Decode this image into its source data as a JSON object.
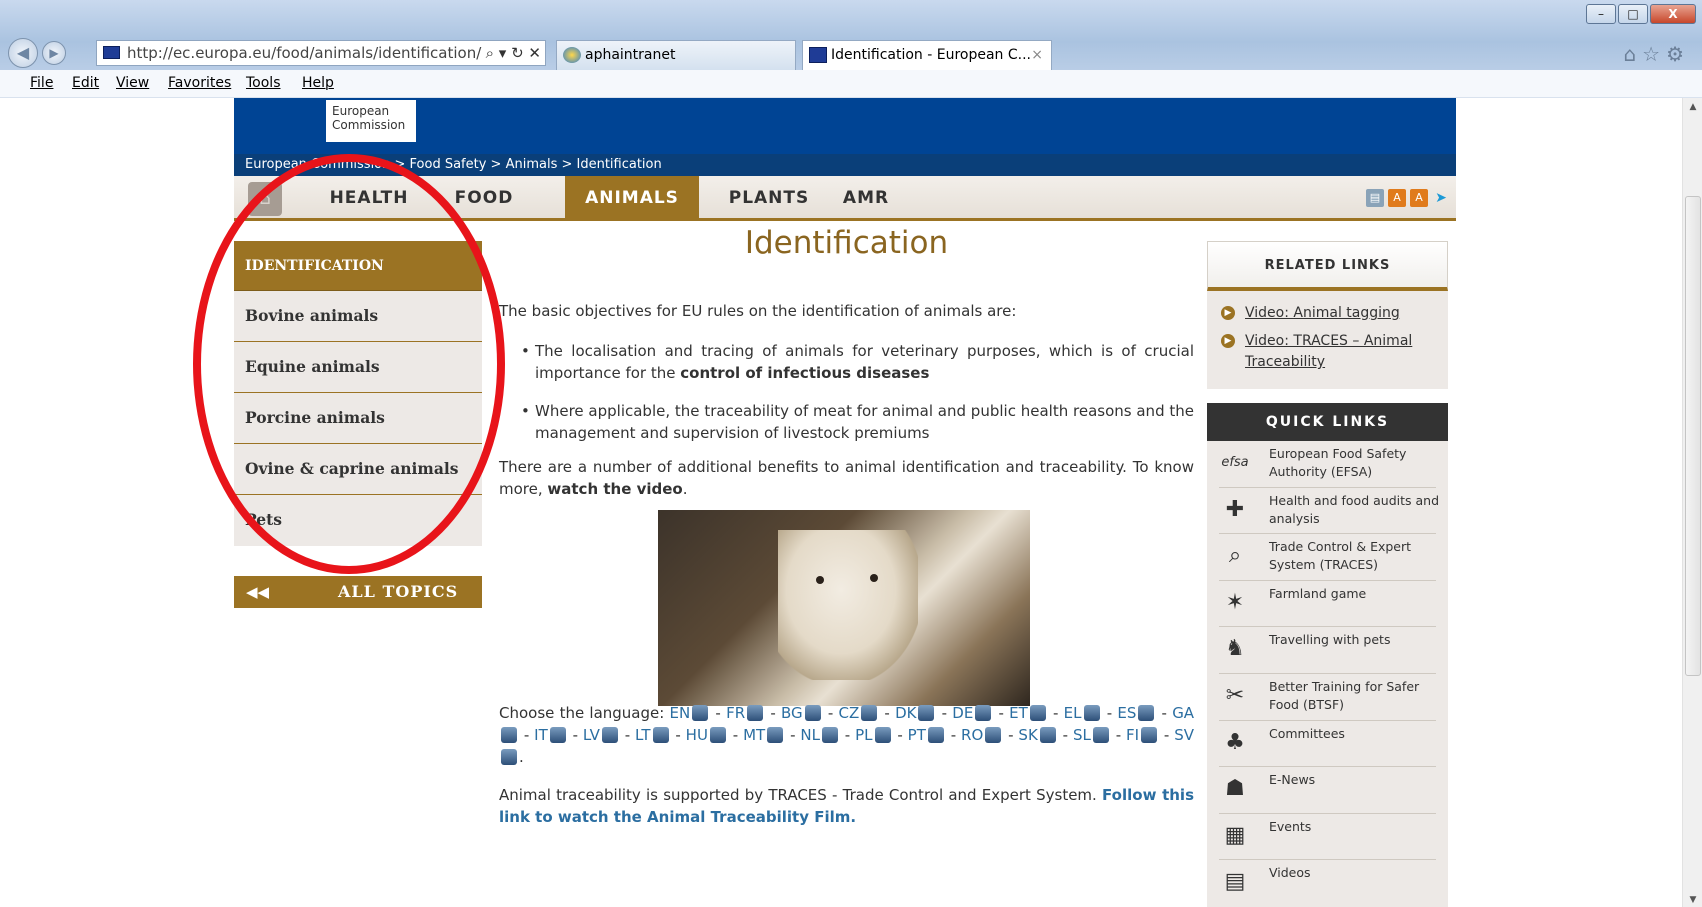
{
  "browser": {
    "url": "http://ec.europa.eu/food/animals/identification/in",
    "url_tools": "⌕ ▾ ↻ ✕",
    "tabs": [
      {
        "label": "aphaintranet"
      },
      {
        "label": "Identification - European C...",
        "close": "×"
      }
    ],
    "menu": [
      "File",
      "Edit",
      "View",
      "Favorites",
      "Tools",
      "Help"
    ],
    "window_buttons": [
      "–",
      "□",
      "X"
    ],
    "right_icons": "⌂☆⚙"
  },
  "site": {
    "logo": [
      "European",
      "Commission"
    ],
    "breadcrumb": "European Commission > Food Safety > Animals > Identification",
    "nav": [
      "HEALTH",
      "FOOD",
      "ANIMALS",
      "PLANTS",
      "AMR"
    ],
    "nav_active": "ANIMALS"
  },
  "sidebar": {
    "header": "IDENTIFICATION",
    "items": [
      "Bovine animals",
      "Equine animals",
      "Porcine animals",
      "Ovine & caprine animals",
      "Pets"
    ],
    "all_topics": "ALL TOPICS",
    "all_topics_arrow": "◀◀"
  },
  "main": {
    "title": "Identification",
    "intro": "The basic objectives for EU rules on the identification of animals are:",
    "bullet1_pre": "The localisation and tracing of animals for veterinary purposes, which is of crucial importance for the ",
    "bullet1_bold": "control of infectious diseases",
    "bullet2": "Where applicable, the traceability of meat for animal and public health reasons and the management and supervision of livestock premiums",
    "benefits_pre": "There are a number of additional benefits to animal identification and traceability. To know more, ",
    "benefits_bold": "watch the video",
    "benefits_end": ".",
    "language_label": "Choose the language: ",
    "languages": [
      "EN",
      "FR",
      "BG",
      "CZ",
      "DK",
      "DE",
      "ET",
      "EL",
      "ES",
      "GA",
      "IT",
      "LV",
      "LT",
      "HU",
      "MT",
      "NL",
      "PL",
      "PT",
      "RO",
      "SK",
      "SL",
      "FI",
      "SV"
    ],
    "traces_pre": "Animal traceability is supported by TRACES - Trade Control and Expert System. ",
    "traces_link": "Follow this link to watch the Animal Traceability Film."
  },
  "related_links": {
    "header": "RELATED LINKS",
    "items": [
      "Video: Animal tagging",
      "Video: TRACES – Animal Traceability"
    ]
  },
  "quick_links": {
    "header": "QUICK LINKS",
    "items": [
      {
        "label": "European Food Safety Authority (EFSA)",
        "icon": "efsa"
      },
      {
        "label": "Health and food audits and analysis",
        "icon": "✚"
      },
      {
        "label": "Trade Control & Expert System (TRACES)",
        "icon": "⌕"
      },
      {
        "label": "Farmland game",
        "icon": "✶"
      },
      {
        "label": "Travelling with pets",
        "icon": "♞"
      },
      {
        "label": "Better Training for Safer Food (BTSF)",
        "icon": "✂"
      },
      {
        "label": "Committees",
        "icon": "♣"
      },
      {
        "label": "E-News",
        "icon": "☗"
      },
      {
        "label": "Events",
        "icon": "▦"
      },
      {
        "label": "Videos",
        "icon": "▤"
      }
    ]
  },
  "colors": {
    "ec_blue": "#004494",
    "accent_gold": "#9b7323",
    "highlight_red": "#e8141a"
  }
}
